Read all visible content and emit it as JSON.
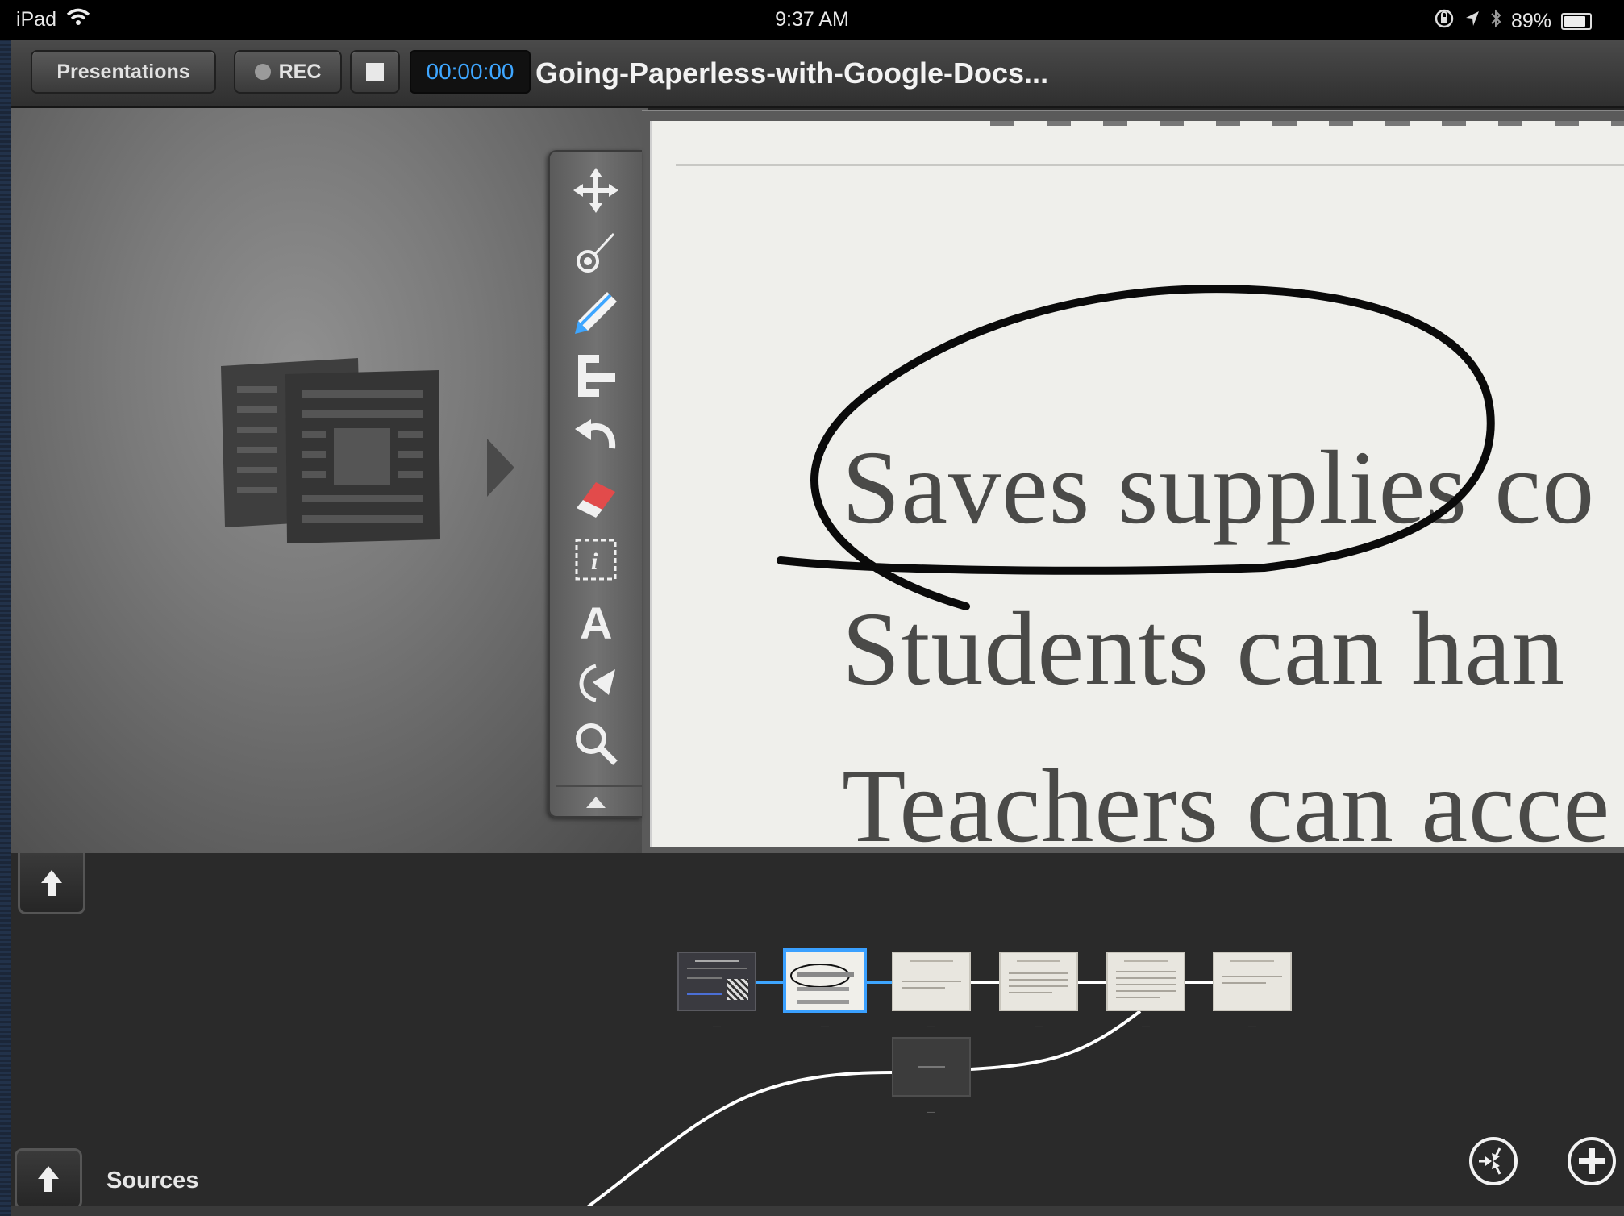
{
  "status_bar": {
    "device": "iPad",
    "time": "9:37 AM",
    "battery": "89%"
  },
  "toolbar": {
    "presentations_label": "Presentations",
    "rec_label": "REC",
    "timer": "00:00:00",
    "title": "Going-Paperless-with-Google-Docs...",
    "accent_color": "#3ea6ff"
  },
  "tools": [
    {
      "name": "move-tool",
      "icon": "four-arrows-icon"
    },
    {
      "name": "laser-pointer-tool",
      "icon": "laser-pointer-icon"
    },
    {
      "name": "pen-tool",
      "icon": "pen-icon",
      "selected": true
    },
    {
      "name": "highlighter-tool",
      "icon": "highlighter-icon"
    },
    {
      "name": "undo-tool",
      "icon": "undo-icon"
    },
    {
      "name": "eraser-tool",
      "icon": "eraser-icon"
    },
    {
      "name": "info-tool",
      "icon": "info-icon"
    },
    {
      "name": "text-tool",
      "icon": "text-a-icon"
    },
    {
      "name": "redo-tool",
      "icon": "redo-icon"
    },
    {
      "name": "zoom-tool",
      "icon": "magnifier-icon"
    }
  ],
  "slide": {
    "lines": [
      "Saves supplies co",
      "Students can han",
      "Teachers can acce"
    ]
  },
  "navigator": {
    "sources_label": "Sources"
  }
}
